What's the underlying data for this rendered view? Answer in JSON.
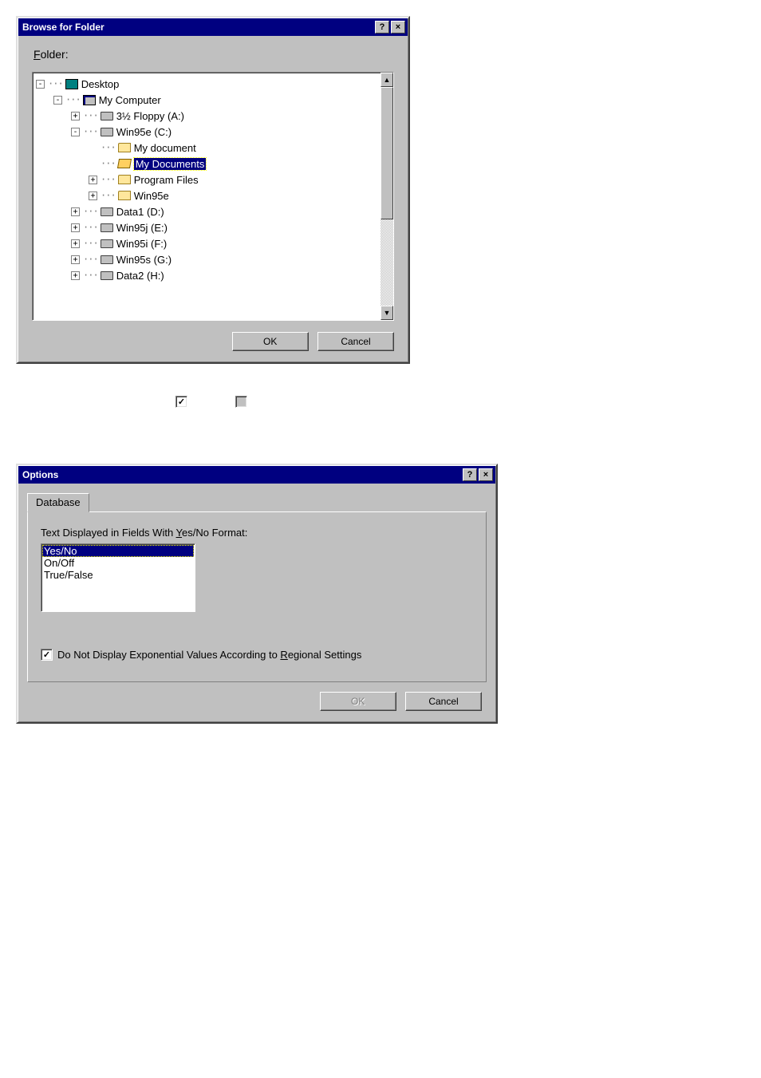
{
  "browse": {
    "title": "Browse for Folder",
    "folder_label": "Folder:",
    "ok": "OK",
    "cancel": "Cancel",
    "tree": [
      {
        "depth": 0,
        "exp": "-",
        "icon": "desktop",
        "label": "Desktop",
        "selected": false
      },
      {
        "depth": 1,
        "exp": "-",
        "icon": "computer",
        "label": "My Computer",
        "selected": false
      },
      {
        "depth": 2,
        "exp": "+",
        "icon": "drive",
        "label": "3½ Floppy (A:)",
        "selected": false
      },
      {
        "depth": 2,
        "exp": "-",
        "icon": "drive",
        "label": "Win95e (C:)",
        "selected": false
      },
      {
        "depth": 3,
        "exp": "",
        "icon": "folder",
        "label": "My document",
        "selected": false
      },
      {
        "depth": 3,
        "exp": "",
        "icon": "folder-open",
        "label": "My Documents",
        "selected": true
      },
      {
        "depth": 3,
        "exp": "+",
        "icon": "folder",
        "label": "Program Files",
        "selected": false
      },
      {
        "depth": 3,
        "exp": "+",
        "icon": "folder",
        "label": "Win95e",
        "selected": false
      },
      {
        "depth": 2,
        "exp": "+",
        "icon": "drive",
        "label": "Data1 (D:)",
        "selected": false
      },
      {
        "depth": 2,
        "exp": "+",
        "icon": "drive",
        "label": "Win95j (E:)",
        "selected": false
      },
      {
        "depth": 2,
        "exp": "+",
        "icon": "drive",
        "label": "Win95i (F:)",
        "selected": false
      },
      {
        "depth": 2,
        "exp": "+",
        "icon": "drive",
        "label": "Win95s (G:)",
        "selected": false
      },
      {
        "depth": 2,
        "exp": "+",
        "icon": "drive",
        "label": "Data2 (H:)",
        "selected": false
      }
    ]
  },
  "standalone": {
    "checked_mark": "✓",
    "unchecked_mark": ""
  },
  "options": {
    "title": "Options",
    "tab": "Database",
    "yesno_label_pre": "Text Displayed in Fields With ",
    "yesno_label_u": "Y",
    "yesno_label_post": "es/No Format:",
    "list": [
      {
        "text": "Yes/No",
        "selected": true
      },
      {
        "text": "On/Off",
        "selected": false
      },
      {
        "text": "True/False",
        "selected": false
      }
    ],
    "exp_check_mark": "✓",
    "exp_label_pre": "Do Not Display Exponential Values According to ",
    "exp_label_u": "R",
    "exp_label_post": "egional Settings",
    "ok": "OK",
    "cancel": "Cancel"
  }
}
